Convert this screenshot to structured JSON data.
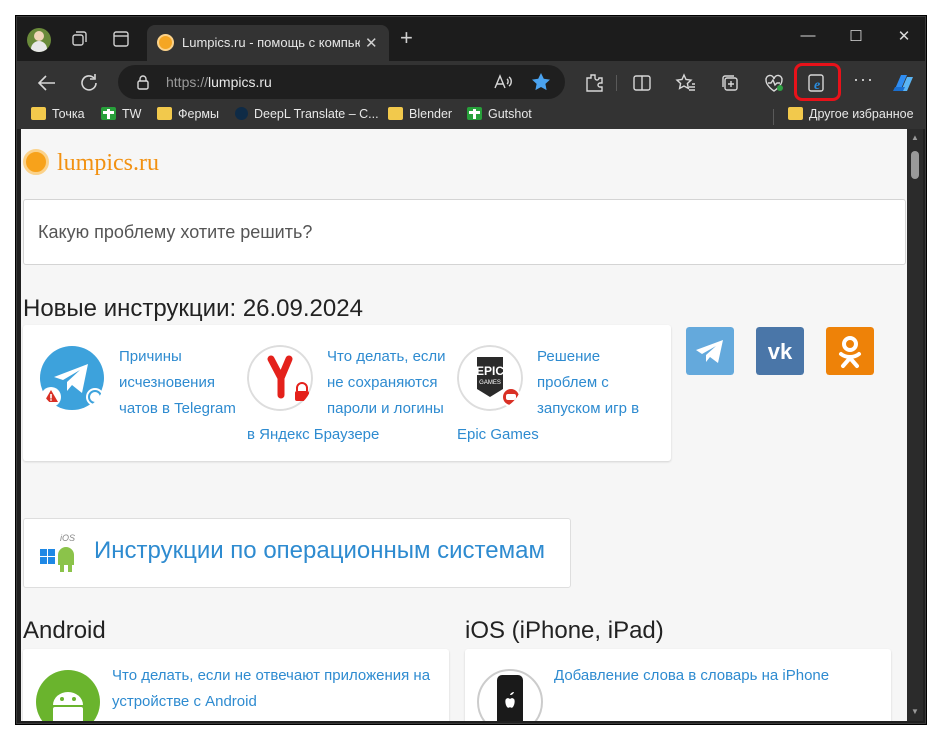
{
  "browser": {
    "tab_title": "Lumpics.ru - помощь с компьютером",
    "url_prefix": "https://",
    "url_host": "lumpics.ru",
    "bookmarks": [
      "Точка",
      "TW",
      "Фермы",
      "DeepL Translate – C...",
      "Blender",
      "Gutshot"
    ],
    "other_bookmarks": "Другое избранное"
  },
  "page": {
    "logo": "lumpics.ru",
    "search_placeholder": "Какую проблему хотите решить?",
    "new_heading": "Новые инструкции: 26.09.2024",
    "news": [
      {
        "lines": [
          "Причины",
          "исчезновения",
          "чатов в Telegram"
        ]
      },
      {
        "lines": [
          "Что делать, если",
          "не сохраняются",
          "пароли и логины",
          "в Яндекс Браузере"
        ]
      },
      {
        "lines": [
          "Решение",
          "проблем с",
          "запуском игр в",
          "Epic Games"
        ]
      }
    ],
    "epic_logo_line1": "EPIC",
    "epic_logo_line2": "GAMES",
    "ios_label": "iOS",
    "os_section": "Инструкции по операционным системам",
    "android_heading": "Android",
    "ios_heading": "iOS (iPhone, iPad)",
    "android_article": [
      "Что делать, если не отвечают приложения на",
      "устройстве с Android"
    ],
    "ios_article": "Добавление слова в словарь на iPhone"
  },
  "colors": {
    "accent_orange": "#f29111",
    "link_blue": "#2e8bd0",
    "telegram": "#64a9dc",
    "vk": "#4a76a8",
    "ok": "#ee8208",
    "highlight_red": "#e8121a"
  }
}
